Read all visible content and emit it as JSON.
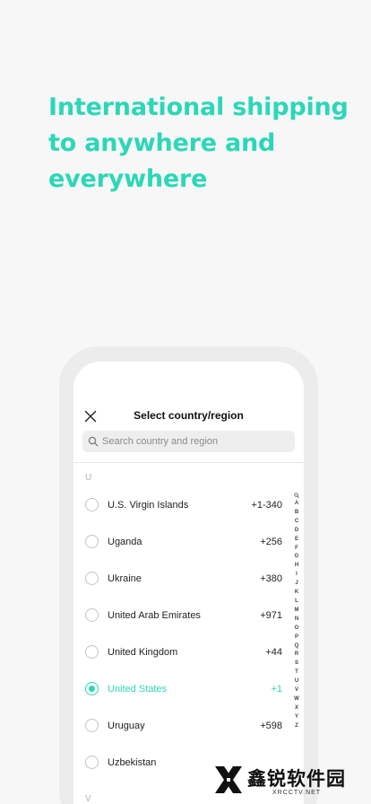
{
  "headline": "International shipping to anywhere and everywhere",
  "modal": {
    "title": "Select country/region",
    "search_placeholder": "Search country and region",
    "section_letter": "U",
    "next_section_letter": "V"
  },
  "countries": [
    {
      "name": "U.S. Virgin Islands",
      "code": "+1-340",
      "selected": false
    },
    {
      "name": "Uganda",
      "code": "+256",
      "selected": false
    },
    {
      "name": "Ukraine",
      "code": "+380",
      "selected": false
    },
    {
      "name": "United Arab Emirates",
      "code": "+971",
      "selected": false
    },
    {
      "name": "United Kingdom",
      "code": "+44",
      "selected": false
    },
    {
      "name": "United States",
      "code": "+1",
      "selected": true
    },
    {
      "name": "Uruguay",
      "code": "+598",
      "selected": false
    },
    {
      "name": "Uzbekistan",
      "code": "",
      "selected": false
    }
  ],
  "alphabet_index": [
    "A",
    "B",
    "C",
    "D",
    "E",
    "F",
    "G",
    "H",
    "I",
    "J",
    "K",
    "L",
    "M",
    "N",
    "O",
    "P",
    "Q",
    "R",
    "S",
    "T",
    "U",
    "V",
    "W",
    "X",
    "Y",
    "Z"
  ],
  "watermark": {
    "text": "鑫锐软件园",
    "sub": "XRCCTV.NET"
  },
  "colors": {
    "accent": "#2cd7b8",
    "background": "#f7f7f7"
  },
  "icons": {
    "close": "close-icon",
    "search": "search-icon"
  }
}
